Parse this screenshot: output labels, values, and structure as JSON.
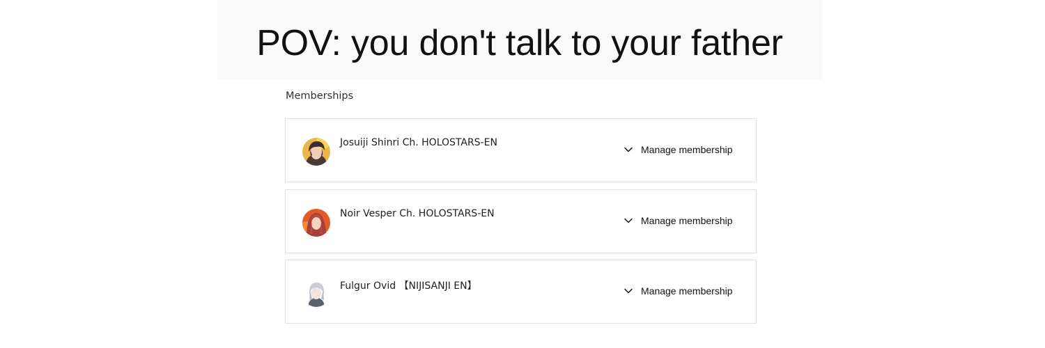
{
  "caption": "POV: you don't talk to your father",
  "section_title": "Memberships",
  "memberships": [
    {
      "channel": "Josuiji Shinri Ch. HOLOSTARS-EN",
      "action": "Manage membership",
      "avatar_icon": "avatar-dark-hair-gold-bg"
    },
    {
      "channel": "Noir Vesper Ch. HOLOSTARS-EN",
      "action": "Manage membership",
      "avatar_icon": "avatar-red-hair-orange-bg"
    },
    {
      "channel": "Fulgur Ovid 【NIJISANJI EN】",
      "action": "Manage membership",
      "avatar_icon": "avatar-white-hair-light-bg"
    }
  ],
  "colors": {
    "card_border": "#e0e0e0",
    "caption_band": "#fafafa",
    "text_primary": "#111111"
  }
}
